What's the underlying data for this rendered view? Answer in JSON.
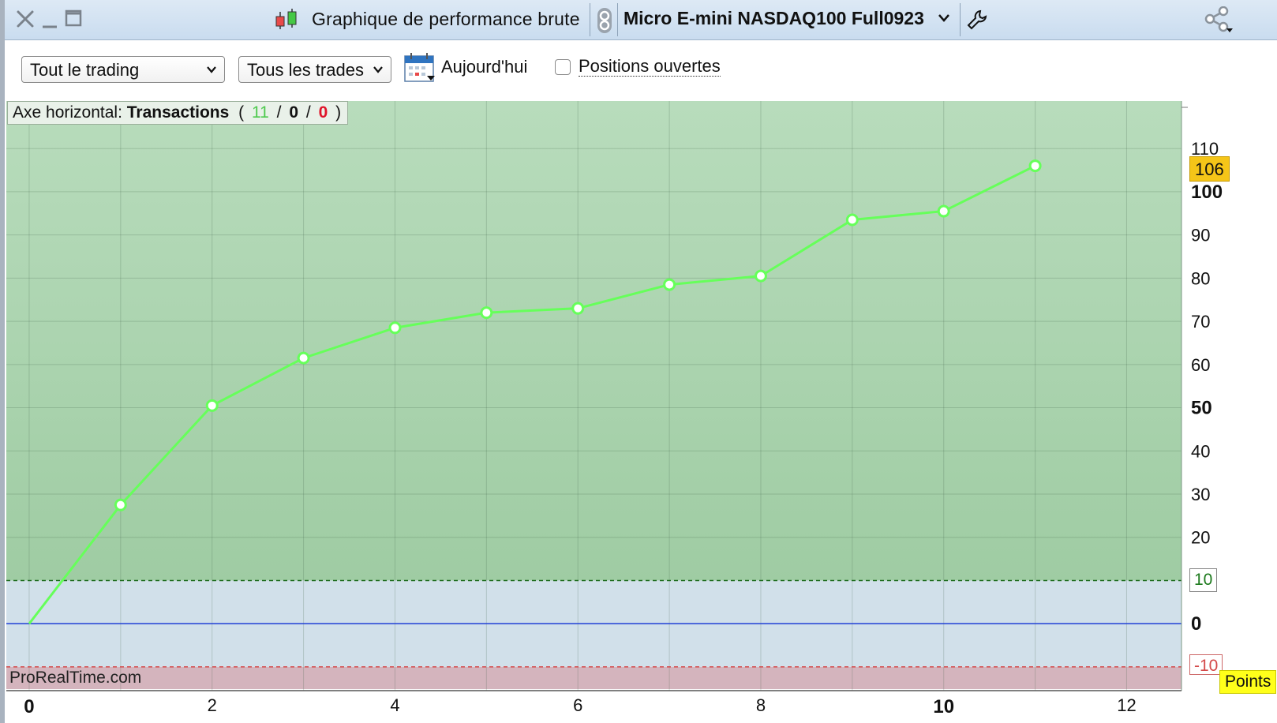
{
  "titlebar": {
    "title": "Graphique de performance brute",
    "instrument": "Micro E-mini NASDAQ100 Full0923"
  },
  "toolbar": {
    "period_select": "Tout le trading",
    "trades_select": "Tous les trades",
    "date_label": "Aujourd'hui",
    "open_positions_label": "Positions ouvertes",
    "open_positions_checked": false
  },
  "legend": {
    "prefix": "Axe horizontal:",
    "axis_name": "Transactions",
    "open_paren": "(",
    "winners": "11",
    "sep1": "/",
    "neutral": "0",
    "sep2": "/",
    "losers": "0",
    "close_paren": ")"
  },
  "watermark": "ProRealTime.com",
  "colors": {
    "line": "#66ff5a",
    "profit_zone": "#9fcca3",
    "neutral_zone": "#d1e0ea",
    "loss_zone": "#d4b4bd",
    "zero_line": "#1f3fd6",
    "upper_dash": "#1d6b1d",
    "lower_dash": "#d44a4a",
    "winners_text": "#4ec94e",
    "losers_text": "#e0142a",
    "last_value_badge": "#f5c518",
    "unit_badge": "#ffff1a"
  },
  "chart_data": {
    "type": "line",
    "x": [
      0,
      1,
      2,
      3,
      4,
      5,
      6,
      7,
      8,
      9,
      10,
      11
    ],
    "values": [
      0,
      27.5,
      50.5,
      61.5,
      68.5,
      72,
      73,
      78.5,
      80.5,
      93.5,
      95.5,
      106
    ],
    "xlim": [
      -0.25,
      12.6
    ],
    "ylim": [
      -15.5,
      121
    ],
    "x_ticks": [
      "0",
      "2",
      "4",
      "6",
      "8",
      "10",
      "12"
    ],
    "y_ticks": [
      "20",
      "30",
      "40",
      "60",
      "70",
      "80",
      "90"
    ],
    "y_ticks_bold": [
      "50",
      "100"
    ],
    "y_tick_110": "110",
    "zero_label": "0",
    "upper_threshold": 10,
    "upper_threshold_label": "10",
    "lower_threshold": -10,
    "lower_threshold_label": "-10",
    "last_value_label": "106",
    "unit_label": "Points",
    "grid": true
  }
}
